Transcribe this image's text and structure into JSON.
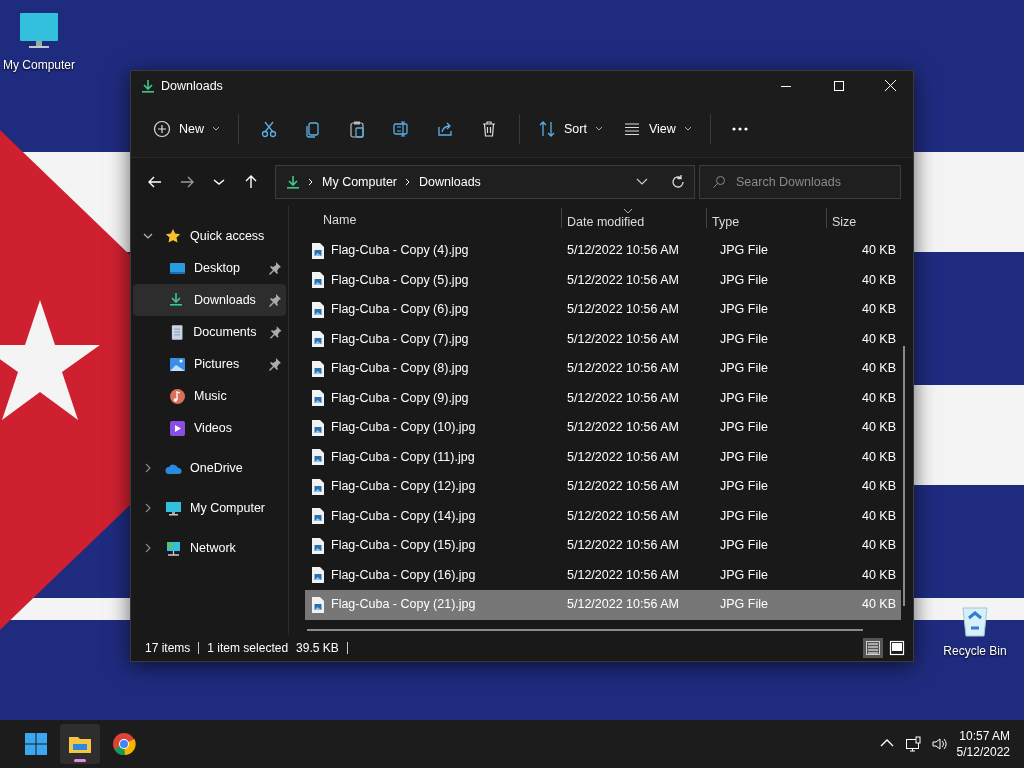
{
  "desktop": {
    "icons": [
      {
        "label": "My Computer",
        "kind": "computer"
      },
      {
        "label": "Recycle Bin",
        "kind": "recycle"
      }
    ]
  },
  "window": {
    "title": "Downloads"
  },
  "toolbar": [
    {
      "kind": "new",
      "label": "New"
    },
    {
      "kind": "cut"
    },
    {
      "kind": "copy"
    },
    {
      "kind": "paste"
    },
    {
      "kind": "rename"
    },
    {
      "kind": "share"
    },
    {
      "kind": "delete"
    },
    {
      "kind": "sort",
      "label": "Sort"
    },
    {
      "kind": "view",
      "label": "View"
    },
    {
      "kind": "more"
    }
  ],
  "address": {
    "path": [
      "My Computer",
      "Downloads"
    ]
  },
  "search": {
    "placeholder": "Search Downloads"
  },
  "sidebar": {
    "items": [
      {
        "label": "Quick access",
        "kind": "star",
        "expanded": true,
        "selected": false,
        "children": [
          {
            "label": "Desktop",
            "kind": "desktop",
            "pinned": true,
            "selected": false
          },
          {
            "label": "Downloads",
            "kind": "downloads",
            "pinned": true,
            "selected": true
          },
          {
            "label": "Documents",
            "kind": "documents",
            "pinned": true,
            "selected": false
          },
          {
            "label": "Pictures",
            "kind": "pictures",
            "pinned": true,
            "selected": false
          },
          {
            "label": "Music",
            "kind": "music",
            "pinned": false,
            "selected": false
          },
          {
            "label": "Videos",
            "kind": "videos",
            "pinned": false,
            "selected": false
          }
        ]
      },
      {
        "label": "OneDrive",
        "kind": "cloud",
        "expanded": false,
        "selected": false
      },
      {
        "label": "My Computer",
        "kind": "computer",
        "expanded": false,
        "selected": false
      },
      {
        "label": "Network",
        "kind": "network",
        "expanded": false,
        "selected": false
      }
    ]
  },
  "table": {
    "columns": [
      {
        "label": "Name",
        "sorted": false
      },
      {
        "label": "Date modified",
        "sorted": true
      },
      {
        "label": "Type",
        "sorted": false
      },
      {
        "label": "Size",
        "sorted": false
      }
    ],
    "rows": [
      {
        "name": "Flag-Cuba - Copy (4).jpg",
        "date": "5/12/2022 10:56 AM",
        "type": "JPG File",
        "size": "40 KB",
        "selected": false
      },
      {
        "name": "Flag-Cuba - Copy (5).jpg",
        "date": "5/12/2022 10:56 AM",
        "type": "JPG File",
        "size": "40 KB",
        "selected": false
      },
      {
        "name": "Flag-Cuba - Copy (6).jpg",
        "date": "5/12/2022 10:56 AM",
        "type": "JPG File",
        "size": "40 KB",
        "selected": false
      },
      {
        "name": "Flag-Cuba - Copy (7).jpg",
        "date": "5/12/2022 10:56 AM",
        "type": "JPG File",
        "size": "40 KB",
        "selected": false
      },
      {
        "name": "Flag-Cuba - Copy (8).jpg",
        "date": "5/12/2022 10:56 AM",
        "type": "JPG File",
        "size": "40 KB",
        "selected": false
      },
      {
        "name": "Flag-Cuba - Copy (9).jpg",
        "date": "5/12/2022 10:56 AM",
        "type": "JPG File",
        "size": "40 KB",
        "selected": false
      },
      {
        "name": "Flag-Cuba - Copy (10).jpg",
        "date": "5/12/2022 10:56 AM",
        "type": "JPG File",
        "size": "40 KB",
        "selected": false
      },
      {
        "name": "Flag-Cuba - Copy (11).jpg",
        "date": "5/12/2022 10:56 AM",
        "type": "JPG File",
        "size": "40 KB",
        "selected": false
      },
      {
        "name": "Flag-Cuba - Copy (12).jpg",
        "date": "5/12/2022 10:56 AM",
        "type": "JPG File",
        "size": "40 KB",
        "selected": false
      },
      {
        "name": "Flag-Cuba - Copy (14).jpg",
        "date": "5/12/2022 10:56 AM",
        "type": "JPG File",
        "size": "40 KB",
        "selected": false
      },
      {
        "name": "Flag-Cuba - Copy (15).jpg",
        "date": "5/12/2022 10:56 AM",
        "type": "JPG File",
        "size": "40 KB",
        "selected": false
      },
      {
        "name": "Flag-Cuba - Copy (16).jpg",
        "date": "5/12/2022 10:56 AM",
        "type": "JPG File",
        "size": "40 KB",
        "selected": false
      },
      {
        "name": "Flag-Cuba - Copy (21).jpg",
        "date": "5/12/2022 10:56 AM",
        "type": "JPG File",
        "size": "40 KB",
        "selected": true
      }
    ]
  },
  "status_bar": {
    "count": "17 items",
    "selection": "1 item selected",
    "size": "39.5 KB"
  },
  "view_buttons": [
    {
      "kind": "details",
      "selected": true
    },
    {
      "kind": "tiles",
      "selected": false
    }
  ],
  "taskbar": {
    "apps": [
      {
        "kind": "start",
        "active": false
      },
      {
        "kind": "explorer",
        "active": true
      },
      {
        "kind": "browser",
        "active": false
      }
    ],
    "time": "10:57 AM",
    "date": "5/12/2022"
  }
}
